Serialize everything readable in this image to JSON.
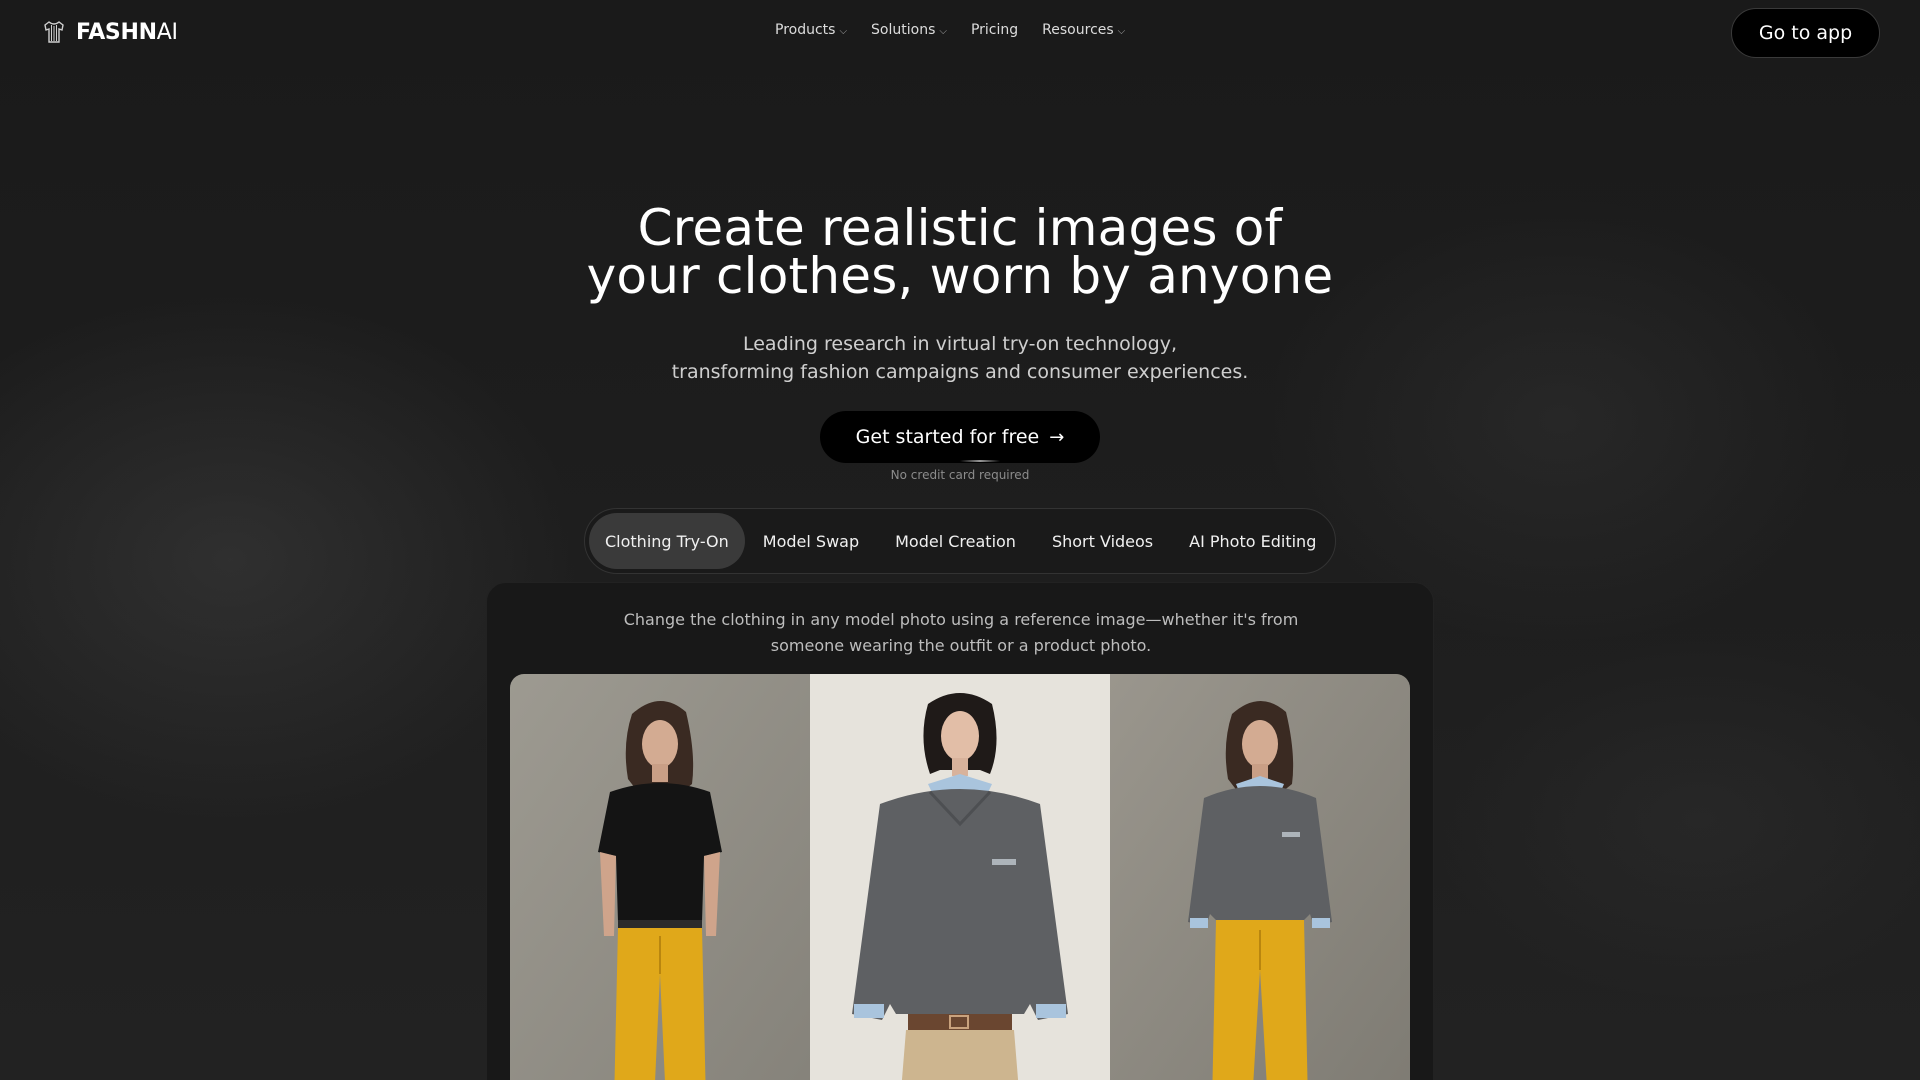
{
  "brand": {
    "name_bold": "FASHN",
    "name_light": "AI"
  },
  "nav": {
    "items": [
      {
        "label": "Products",
        "has_menu": true
      },
      {
        "label": "Solutions",
        "has_menu": true
      },
      {
        "label": "Pricing",
        "has_menu": false
      },
      {
        "label": "Resources",
        "has_menu": true
      }
    ],
    "go_to_app": "Go to app"
  },
  "hero": {
    "title_line1": "Create realistic images of",
    "title_line2": "your clothes, worn by anyone",
    "subtitle_line1": "Leading research in virtual try-on technology,",
    "subtitle_line2": "transforming fashion campaigns and consumer experiences.",
    "cta": "Get started for free",
    "cta_note": "No credit card required"
  },
  "tabs": [
    {
      "label": "Clothing Try-On",
      "active": true
    },
    {
      "label": "Model Swap",
      "active": false
    },
    {
      "label": "Model Creation",
      "active": false
    },
    {
      "label": "Short Videos",
      "active": false
    },
    {
      "label": "AI Photo Editing",
      "active": false
    }
  ],
  "panel": {
    "description_line1": "Change the clothing in any model photo using a reference image—whether it's from",
    "description_line2": "someone wearing the outfit or a product photo."
  },
  "colors": {
    "background": "#1b1b1b",
    "button_black": "#000000",
    "tab_active": "#3a3a3a",
    "pants_yellow": "#e0a81a",
    "sweater_grey": "#5e6063",
    "collar_blue": "#a9c4dd"
  }
}
